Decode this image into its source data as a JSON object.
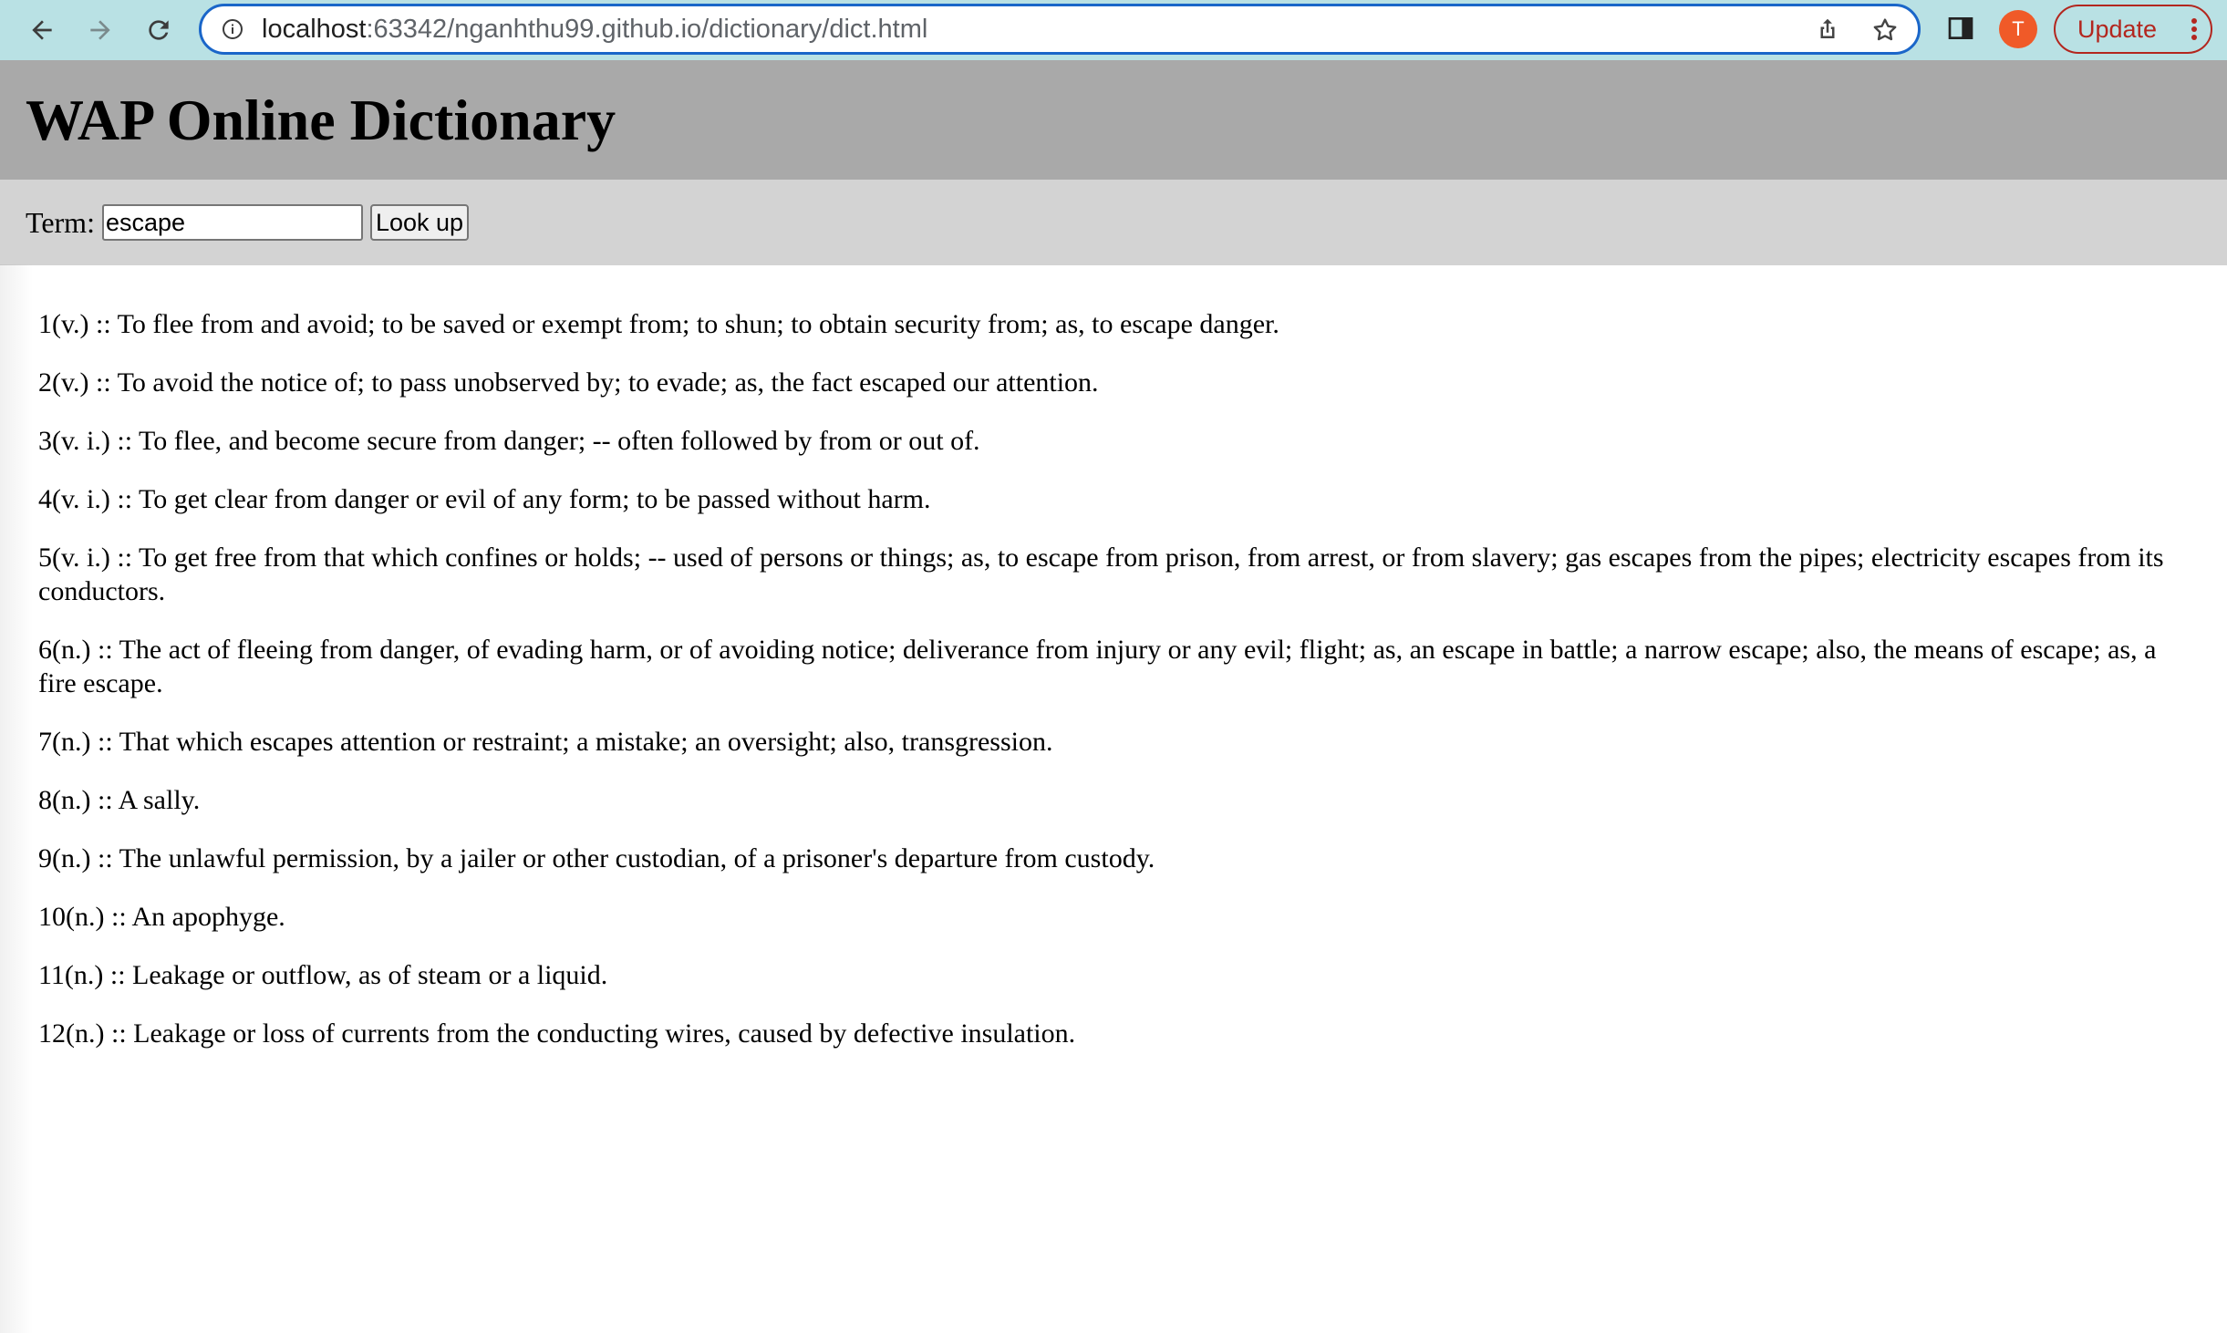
{
  "browser": {
    "url_host": "localhost",
    "url_rest": ":63342/nganhthu99.github.io/dictionary/dict.html",
    "profile_initial": "T",
    "update_label": "Update",
    "icons": [
      "back-arrow-icon",
      "forward-arrow-icon",
      "reload-icon",
      "site-info-icon",
      "share-icon",
      "bookmark-star-icon",
      "side-panel-icon",
      "kebab-menu-icon"
    ]
  },
  "page": {
    "title": "WAP Online Dictionary",
    "term_label": "Term:",
    "term_value": "escape",
    "lookup_label": "Look up",
    "colors": {
      "header_bg": "#a9a9a9",
      "search_bg": "#d3d3d3"
    }
  },
  "definitions": [
    "1(v.) :: To flee from and avoid; to be saved or exempt from; to shun; to obtain security from; as, to escape danger.",
    "2(v.) :: To avoid the notice of; to pass unobserved by; to evade; as, the fact escaped our attention.",
    "3(v. i.) :: To flee, and become secure from danger; -- often followed by from or out of.",
    "4(v. i.) :: To get clear from danger or evil of any form; to be passed without harm.",
    "5(v. i.) :: To get free from that which confines or holds; -- used of persons or things; as, to escape from prison, from arrest, or from slavery; gas escapes from the pipes; electricity escapes from its conductors.",
    "6(n.) :: The act of fleeing from danger, of evading harm, or of avoiding notice; deliverance from injury or any evil; flight; as, an escape in battle; a narrow escape; also, the means of escape; as, a fire escape.",
    "7(n.) :: That which escapes attention or restraint; a mistake; an oversight; also, transgression.",
    "8(n.) :: A sally.",
    "9(n.) :: The unlawful permission, by a jailer or other custodian, of a prisoner's departure from custody.",
    "10(n.) :: An apophyge.",
    "11(n.) :: Leakage or outflow, as of steam or a liquid.",
    "12(n.) :: Leakage or loss of currents from the conducting wires, caused by defective insulation."
  ]
}
